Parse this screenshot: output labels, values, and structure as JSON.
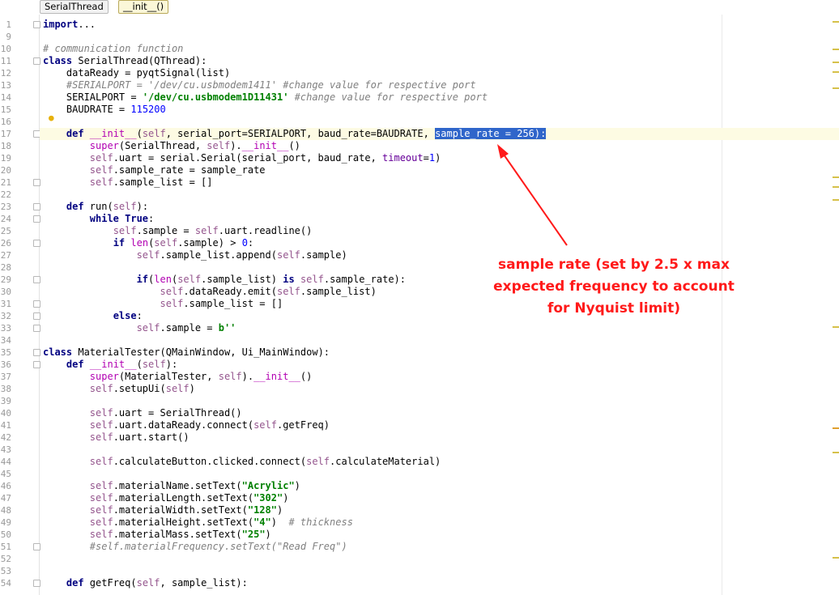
{
  "breadcrumbs": [
    "SerialThread",
    "__init__()"
  ],
  "annotation": {
    "lines": [
      "sample rate (set by 2.5 x max",
      "expected frequency to account",
      "for Nyquist limit)"
    ],
    "color": "#ff1a1a"
  },
  "code_lines": [
    {
      "n": "1",
      "indent": 0,
      "fold": true,
      "tokens": [
        [
          "kw",
          "import"
        ],
        [
          "",
          "..."
        ]
      ]
    },
    {
      "n": "9",
      "indent": 0,
      "tokens": []
    },
    {
      "n": "10",
      "indent": 0,
      "tokens": [
        [
          "cmt",
          "# communication function"
        ]
      ]
    },
    {
      "n": "11",
      "indent": 0,
      "fold": true,
      "tokens": [
        [
          "kw",
          "class "
        ],
        [
          "",
          "SerialThread(QThread):"
        ]
      ]
    },
    {
      "n": "12",
      "indent": 4,
      "tokens": [
        [
          "",
          "dataReady = pyqtSignal(list)"
        ]
      ]
    },
    {
      "n": "13",
      "indent": 4,
      "tokens": [
        [
          "cmt",
          "#SERIALPORT = '/dev/cu.usbmodem1411' #change value for respective port"
        ]
      ]
    },
    {
      "n": "14",
      "indent": 4,
      "tokens": [
        [
          "",
          "SERIALPORT = "
        ],
        [
          "str",
          "'/dev/cu.usbmodem1D11431'"
        ],
        [
          "cmt",
          " #change value for respective port"
        ]
      ]
    },
    {
      "n": "15",
      "indent": 4,
      "tokens": [
        [
          "",
          "BAUDRATE = "
        ],
        [
          "num",
          "115200"
        ]
      ]
    },
    {
      "n": "16",
      "indent": 0,
      "tokens": []
    },
    {
      "n": "17",
      "indent": 4,
      "fold": true,
      "current": true,
      "tokens": [
        [
          "kw",
          "def "
        ],
        [
          "mag",
          "__init__"
        ],
        [
          "",
          "("
        ],
        [
          "slf",
          "self"
        ],
        [
          "",
          ", serial_port=SERIALPORT, baud_rate=BAUDRATE, "
        ],
        [
          "sel",
          "sample_rate = 256):"
        ]
      ]
    },
    {
      "n": "18",
      "indent": 8,
      "tokens": [
        [
          "mag",
          "super"
        ],
        [
          "",
          "(SerialThread, "
        ],
        [
          "slf",
          "self"
        ],
        [
          "",
          ")."
        ],
        [
          "mag",
          "__init__"
        ],
        [
          "",
          "()"
        ]
      ]
    },
    {
      "n": "19",
      "indent": 8,
      "tokens": [
        [
          "slf",
          "self"
        ],
        [
          "",
          ".uart = serial.Serial(serial_port, baud_rate, "
        ],
        [
          "prm",
          "timeout"
        ],
        [
          "",
          "="
        ],
        [
          "num",
          "1"
        ],
        [
          "",
          ")"
        ]
      ]
    },
    {
      "n": "20",
      "indent": 8,
      "tokens": [
        [
          "slf",
          "self"
        ],
        [
          "",
          ".sample_rate = sample_rate"
        ]
      ]
    },
    {
      "n": "21",
      "indent": 8,
      "fold": true,
      "tokens": [
        [
          "slf",
          "self"
        ],
        [
          "",
          ".sample_list = []"
        ]
      ]
    },
    {
      "n": "22",
      "indent": 0,
      "tokens": []
    },
    {
      "n": "23",
      "indent": 4,
      "fold": true,
      "tokens": [
        [
          "kw",
          "def "
        ],
        [
          "",
          "run("
        ],
        [
          "slf",
          "self"
        ],
        [
          "",
          "):"
        ]
      ]
    },
    {
      "n": "24",
      "indent": 8,
      "fold": true,
      "tokens": [
        [
          "kw",
          "while True"
        ],
        [
          "",
          ":"
        ]
      ]
    },
    {
      "n": "25",
      "indent": 12,
      "tokens": [
        [
          "slf",
          "self"
        ],
        [
          "",
          ".sample = "
        ],
        [
          "slf",
          "self"
        ],
        [
          "",
          ".uart.readline()"
        ]
      ]
    },
    {
      "n": "26",
      "indent": 12,
      "fold": true,
      "tokens": [
        [
          "kw",
          "if "
        ],
        [
          "mag",
          "len"
        ],
        [
          "",
          "("
        ],
        [
          "slf",
          "self"
        ],
        [
          "",
          ".sample) > "
        ],
        [
          "num",
          "0"
        ],
        [
          "",
          ":"
        ]
      ]
    },
    {
      "n": "27",
      "indent": 16,
      "tokens": [
        [
          "slf",
          "self"
        ],
        [
          "",
          ".sample_list.append("
        ],
        [
          "slf",
          "self"
        ],
        [
          "",
          ".sample)"
        ]
      ]
    },
    {
      "n": "28",
      "indent": 0,
      "tokens": []
    },
    {
      "n": "29",
      "indent": 16,
      "fold": true,
      "tokens": [
        [
          "kw",
          "if"
        ],
        [
          "",
          "("
        ],
        [
          "mag",
          "len"
        ],
        [
          "",
          "("
        ],
        [
          "slf",
          "self"
        ],
        [
          "",
          ".sample_list) "
        ],
        [
          "kw",
          "is "
        ],
        [
          "slf",
          "self"
        ],
        [
          "",
          ".sample_rate):"
        ]
      ]
    },
    {
      "n": "30",
      "indent": 20,
      "tokens": [
        [
          "slf",
          "self"
        ],
        [
          "",
          ".dataReady.emit("
        ],
        [
          "slf",
          "self"
        ],
        [
          "",
          ".sample_list)"
        ]
      ]
    },
    {
      "n": "31",
      "indent": 20,
      "fold": true,
      "tokens": [
        [
          "slf",
          "self"
        ],
        [
          "",
          ".sample_list = []"
        ]
      ]
    },
    {
      "n": "32",
      "indent": 12,
      "fold": true,
      "tokens": [
        [
          "kw",
          "else"
        ],
        [
          "",
          ":"
        ]
      ]
    },
    {
      "n": "33",
      "indent": 16,
      "fold": true,
      "tokens": [
        [
          "slf",
          "self"
        ],
        [
          "",
          ".sample = "
        ],
        [
          "str",
          "b''"
        ]
      ]
    },
    {
      "n": "34",
      "indent": 0,
      "tokens": []
    },
    {
      "n": "35",
      "indent": 0,
      "fold": true,
      "tokens": [
        [
          "kw",
          "class "
        ],
        [
          "",
          "MaterialTester(QMainWindow, Ui_MainWindow):"
        ]
      ]
    },
    {
      "n": "36",
      "indent": 4,
      "fold": true,
      "tokens": [
        [
          "kw",
          "def "
        ],
        [
          "mag",
          "__init__"
        ],
        [
          "",
          "("
        ],
        [
          "slf",
          "self"
        ],
        [
          "",
          "):"
        ]
      ]
    },
    {
      "n": "37",
      "indent": 8,
      "tokens": [
        [
          "mag",
          "super"
        ],
        [
          "",
          "(MaterialTester, "
        ],
        [
          "slf",
          "self"
        ],
        [
          "",
          ")."
        ],
        [
          "mag",
          "__init__"
        ],
        [
          "",
          "()"
        ]
      ]
    },
    {
      "n": "38",
      "indent": 8,
      "tokens": [
        [
          "slf",
          "self"
        ],
        [
          "",
          ".setupUi("
        ],
        [
          "slf",
          "self"
        ],
        [
          "",
          ")"
        ]
      ]
    },
    {
      "n": "39",
      "indent": 0,
      "tokens": []
    },
    {
      "n": "40",
      "indent": 8,
      "tokens": [
        [
          "slf",
          "self"
        ],
        [
          "",
          ".uart = SerialThread()"
        ]
      ]
    },
    {
      "n": "41",
      "indent": 8,
      "tokens": [
        [
          "slf",
          "self"
        ],
        [
          "",
          ".uart.dataReady.connect("
        ],
        [
          "slf",
          "self"
        ],
        [
          "",
          ".getFreq)"
        ]
      ]
    },
    {
      "n": "42",
      "indent": 8,
      "tokens": [
        [
          "slf",
          "self"
        ],
        [
          "",
          ".uart.start()"
        ]
      ]
    },
    {
      "n": "43",
      "indent": 0,
      "tokens": []
    },
    {
      "n": "44",
      "indent": 8,
      "tokens": [
        [
          "slf",
          "self"
        ],
        [
          "",
          ".calculateButton.clicked.connect("
        ],
        [
          "slf",
          "self"
        ],
        [
          "",
          ".calculateMaterial)"
        ]
      ]
    },
    {
      "n": "45",
      "indent": 0,
      "tokens": []
    },
    {
      "n": "46",
      "indent": 8,
      "tokens": [
        [
          "slf",
          "self"
        ],
        [
          "",
          ".materialName.setText("
        ],
        [
          "str",
          "\"Acrylic\""
        ],
        [
          "",
          ")"
        ]
      ]
    },
    {
      "n": "47",
      "indent": 8,
      "tokens": [
        [
          "slf",
          "self"
        ],
        [
          "",
          ".materialLength.setText("
        ],
        [
          "str",
          "\"302\""
        ],
        [
          "",
          ")"
        ]
      ]
    },
    {
      "n": "48",
      "indent": 8,
      "tokens": [
        [
          "slf",
          "self"
        ],
        [
          "",
          ".materialWidth.setText("
        ],
        [
          "str",
          "\"128\""
        ],
        [
          "",
          ")"
        ]
      ]
    },
    {
      "n": "49",
      "indent": 8,
      "tokens": [
        [
          "slf",
          "self"
        ],
        [
          "",
          ".materialHeight.setText("
        ],
        [
          "str",
          "\"4\""
        ],
        [
          "",
          ")  "
        ],
        [
          "cmt",
          "# thickness"
        ]
      ]
    },
    {
      "n": "50",
      "indent": 8,
      "tokens": [
        [
          "slf",
          "self"
        ],
        [
          "",
          ".materialMass.setText("
        ],
        [
          "str",
          "\"25\""
        ],
        [
          "",
          ")"
        ]
      ]
    },
    {
      "n": "51",
      "indent": 8,
      "fold": true,
      "tokens": [
        [
          "cmt",
          "#self.materialFrequency.setText(\"Read Freq\")"
        ]
      ]
    },
    {
      "n": "52",
      "indent": 0,
      "tokens": []
    },
    {
      "n": "53",
      "indent": 0,
      "tokens": []
    },
    {
      "n": "54",
      "indent": 4,
      "fold": true,
      "tokens": [
        [
          "kw",
          "def "
        ],
        [
          "",
          "getFreq("
        ],
        [
          "slf",
          "self"
        ],
        [
          "",
          ", sample_list):"
        ]
      ]
    }
  ],
  "scroll_marks": [
    {
      "color": "#d6c14a"
    },
    {
      "color": "#d6c14a"
    },
    {
      "color": "#d6c14a"
    },
    {
      "color": "#d6c14a"
    },
    {
      "color": "#d6c14a"
    },
    {
      "color": "#d6c14a"
    },
    {
      "color": "#d6c14a"
    },
    {
      "color": "#d6c14a"
    },
    {
      "color": "#d6c14a"
    },
    {
      "color": "#e0a030"
    },
    {
      "color": "#d6c14a"
    },
    {
      "color": "#d6c14a"
    }
  ]
}
